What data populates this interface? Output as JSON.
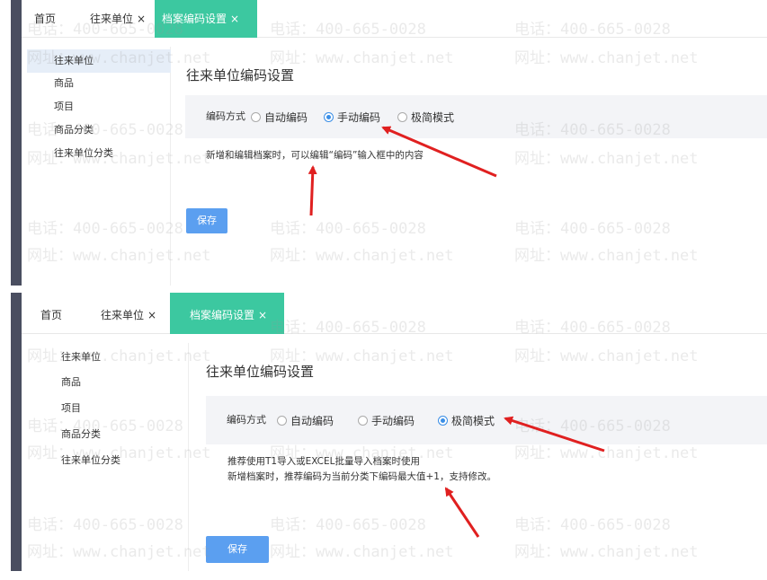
{
  "tabs": {
    "home": "首页",
    "partners": "往来单位",
    "close": "×",
    "active": "档案编码设置"
  },
  "sidebar": {
    "items": [
      "往来单位",
      "商品",
      "项目",
      "商品分类",
      "往来单位分类"
    ]
  },
  "page_title": "往来单位编码设置",
  "mode_label": "编码方式",
  "radios": {
    "auto": "自动编码",
    "manual": "手动编码",
    "simple": "极简模式"
  },
  "panel1": {
    "selected": "manual",
    "hint": "新增和编辑档案时，可以编辑“编码”输入框中的内容"
  },
  "panel2": {
    "selected": "simple",
    "hint_line1": "推荐使用T1导入或EXCEL批量导入档案时使用",
    "hint_line2": "新增档案时，推荐编码为当前分类下编码最大值+1，支持修改。"
  },
  "save_label": "保存",
  "watermark": {
    "phone": "电话：400-665-0028",
    "site": "网址：www.chanjet.net"
  },
  "colors": {
    "active_tab": "#3cc8a0",
    "save_button": "#5b9ff0",
    "arrow": "#e02020",
    "radio_checked": "#3a8ee6"
  }
}
